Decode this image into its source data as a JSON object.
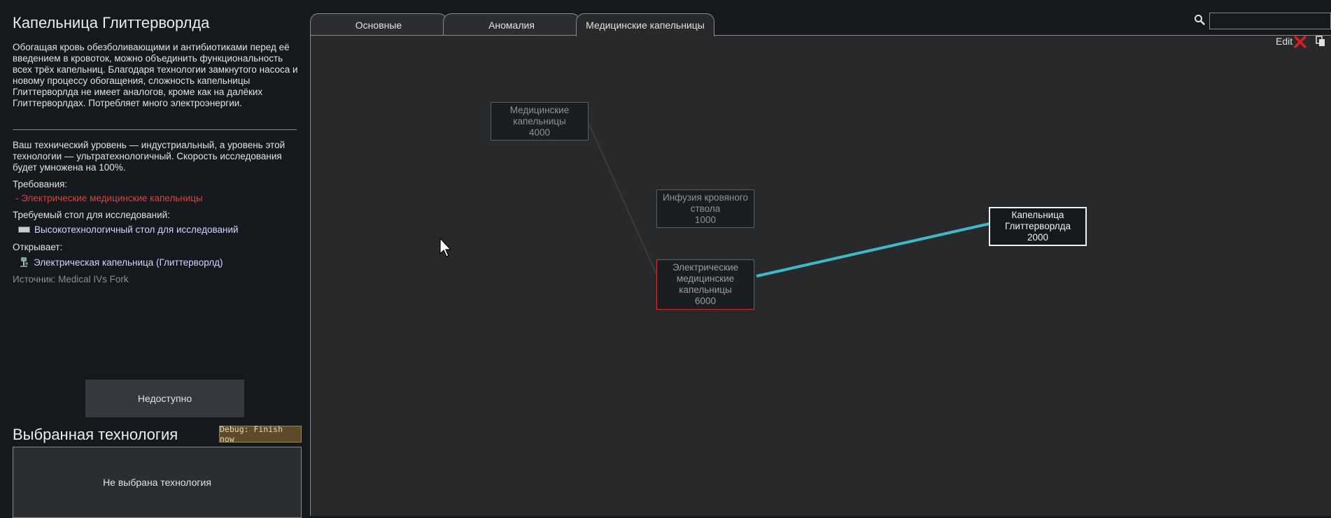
{
  "left": {
    "title": "Капельница Глиттерворлда",
    "description": "Обогащая кровь обезболивающими и антибиотиками перед её введением в кровоток, можно объединить функциональность всех трёх капельниц. Благодаря технологии замкнутого насоса и новому процессу обогащения, сложность капельницы Глиттерворлда не имеет аналогов, кроме как на далёких Глиттерворлдах. Потребляет много электроэнергии.",
    "tech_info": "Ваш технический уровень — индустриальный, а уровень этой технологии — ультратехнологичный. Скорость исследования будет умножена на 100%.",
    "requirements_label": "Требования:",
    "requirement_item": "- Электрические медицинские капельницы",
    "bench_label": "Требуемый стол для исследований:",
    "bench_item": "Высокотехнологичный стол для исследований",
    "unlocks_label": "Открывает:",
    "unlock_item": "Электрическая капельница (Глиттерворлд)",
    "source": "Источник:  Medical IVs Fork",
    "unavailable_button": "Недоступно",
    "chosen_title": "Выбранная технология",
    "debug_button": "Debug: Finish now",
    "chosen_empty": "Не выбрана технология"
  },
  "tabs": [
    {
      "label": "Основные"
    },
    {
      "label": "Аномалия"
    },
    {
      "label": "Медицинские капельницы"
    }
  ],
  "search": {
    "placeholder": ""
  },
  "edit_label": "Edit",
  "nodes": {
    "med": {
      "name": "Медицинские капельницы",
      "cost": "4000"
    },
    "blood": {
      "name": "Инфузия кровяного ствола",
      "cost": "1000"
    },
    "elec": {
      "name": "Электрические медицинские капельницы",
      "cost": "6000"
    },
    "glitter": {
      "name": "Капельница Глиттерворлда",
      "cost": "2000"
    }
  },
  "colors": {
    "requirement": "#e0413a",
    "link_highlight": "#3fb8c8",
    "panel_bg": "#15191d",
    "tree_bg": "#28292b"
  }
}
